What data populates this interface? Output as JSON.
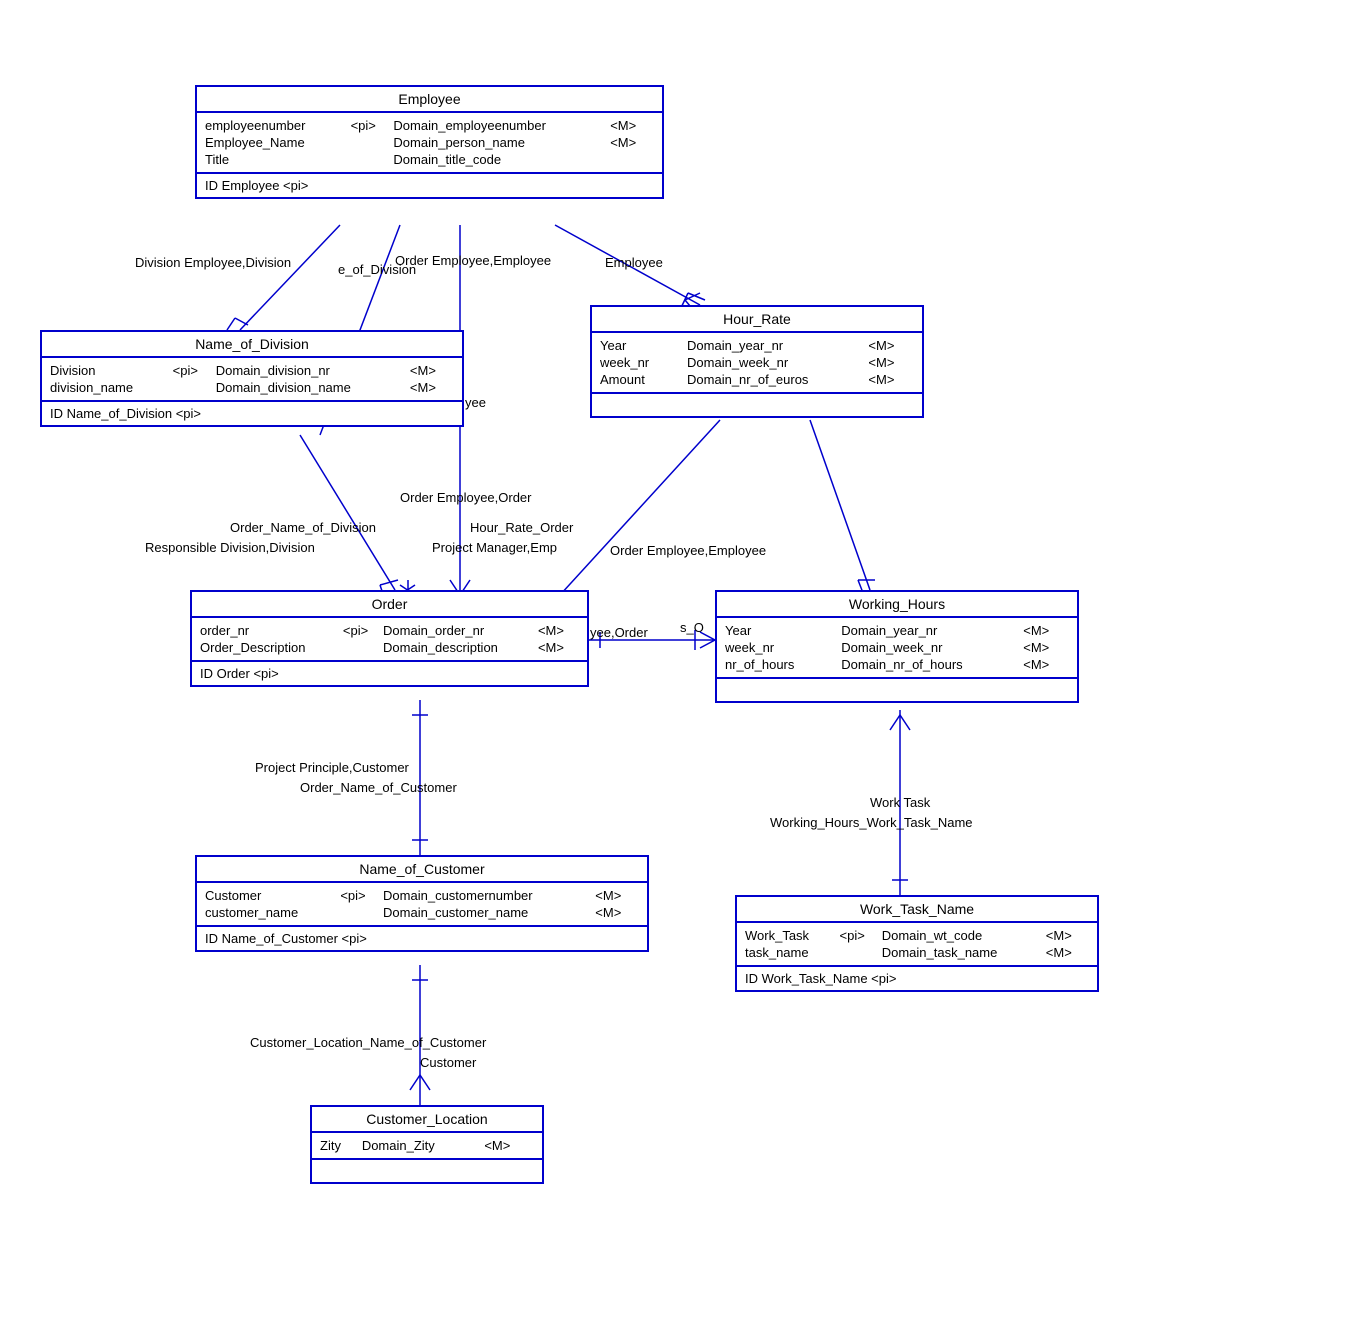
{
  "entities": {
    "employee": {
      "title": "Employee",
      "attrs": [
        {
          "name": "employeenumber",
          "pi": "<pi>",
          "domain": "Domain_employeenumber",
          "m": "<M>"
        },
        {
          "name": "Employee_Name",
          "pi": "",
          "domain": "Domain_person_name",
          "m": "<M>"
        },
        {
          "name": "Title",
          "pi": "",
          "domain": "Domain_title_code",
          "m": ""
        }
      ],
      "id": "ID Employee  <pi>"
    },
    "division": {
      "title": "Name_of_Division",
      "attrs": [
        {
          "name": "Division",
          "pi": "<pi>",
          "domain": "Domain_division_nr",
          "m": "<M>"
        },
        {
          "name": "division_name",
          "pi": "",
          "domain": "Domain_division_name",
          "m": "<M>"
        }
      ],
      "id": "ID Name_of_Division  <pi>"
    },
    "hourrate": {
      "title": "Hour_Rate",
      "attrs": [
        {
          "name": "Year",
          "pi": "",
          "domain": "Domain_year_nr",
          "m": "<M>"
        },
        {
          "name": "week_nr",
          "pi": "",
          "domain": "Domain_week_nr",
          "m": "<M>"
        },
        {
          "name": "Amount",
          "pi": "",
          "domain": "Domain_nr_of_euros",
          "m": "<M>"
        }
      ],
      "id": ""
    },
    "order": {
      "title": "Order",
      "attrs": [
        {
          "name": "order_nr",
          "pi": "<pi>",
          "domain": "Domain_order_nr",
          "m": "<M>"
        },
        {
          "name": "Order_Description",
          "pi": "",
          "domain": "Domain_description",
          "m": "<M>"
        }
      ],
      "id": "ID Order  <pi>"
    },
    "workinghours": {
      "title": "Working_Hours",
      "attrs": [
        {
          "name": "Year",
          "pi": "",
          "domain": "Domain_year_nr",
          "m": "<M>"
        },
        {
          "name": "week_nr",
          "pi": "",
          "domain": "Domain_week_nr",
          "m": "<M>"
        },
        {
          "name": "nr_of_hours",
          "pi": "",
          "domain": "Domain_nr_of_hours",
          "m": "<M>"
        }
      ],
      "id": ""
    },
    "customer": {
      "title": "Name_of_Customer",
      "attrs": [
        {
          "name": "Customer",
          "pi": "<pi>",
          "domain": "Domain_customernumber",
          "m": "<M>"
        },
        {
          "name": "customer_name",
          "pi": "",
          "domain": "Domain_customer_name",
          "m": "<M>"
        }
      ],
      "id": "ID Name_of_Customer  <pi>"
    },
    "worktask": {
      "title": "Work_Task_Name",
      "attrs": [
        {
          "name": "Work_Task",
          "pi": "<pi>",
          "domain": "Domain_wt_code",
          "m": "<M>"
        },
        {
          "name": "task_name",
          "pi": "",
          "domain": "Domain_task_name",
          "m": "<M>"
        }
      ],
      "id": "ID Work_Task_Name  <pi>"
    },
    "custloc": {
      "title": "Customer_Location",
      "attrs": [
        {
          "name": "Zity",
          "pi": "",
          "domain": "Domain_Zity",
          "m": "<M>"
        }
      ],
      "id": ""
    }
  },
  "labels": {
    "l1": "Division Employee,Division",
    "l2": "e_of_Division",
    "l3": "Order Employee,Employee",
    "l4": "Employee",
    "l5": "yee",
    "l6": "Order Employee,Order",
    "l7": "Order_Name_of_Division",
    "l8": "Responsible Division,Division",
    "l9": "Hour_Rate_Order",
    "l10": "Project Manager,Emp",
    "l11": "Order Employee,Employee",
    "l12": "yee,Order",
    "l13": "s_O",
    "l14": "Project Principle,Customer",
    "l15": "Order_Name_of_Customer",
    "l16": "Work Task",
    "l17": "Working_Hours_Work_Task_Name",
    "l18": "Customer_Location_Name_of_Customer",
    "l19": "Customer"
  }
}
